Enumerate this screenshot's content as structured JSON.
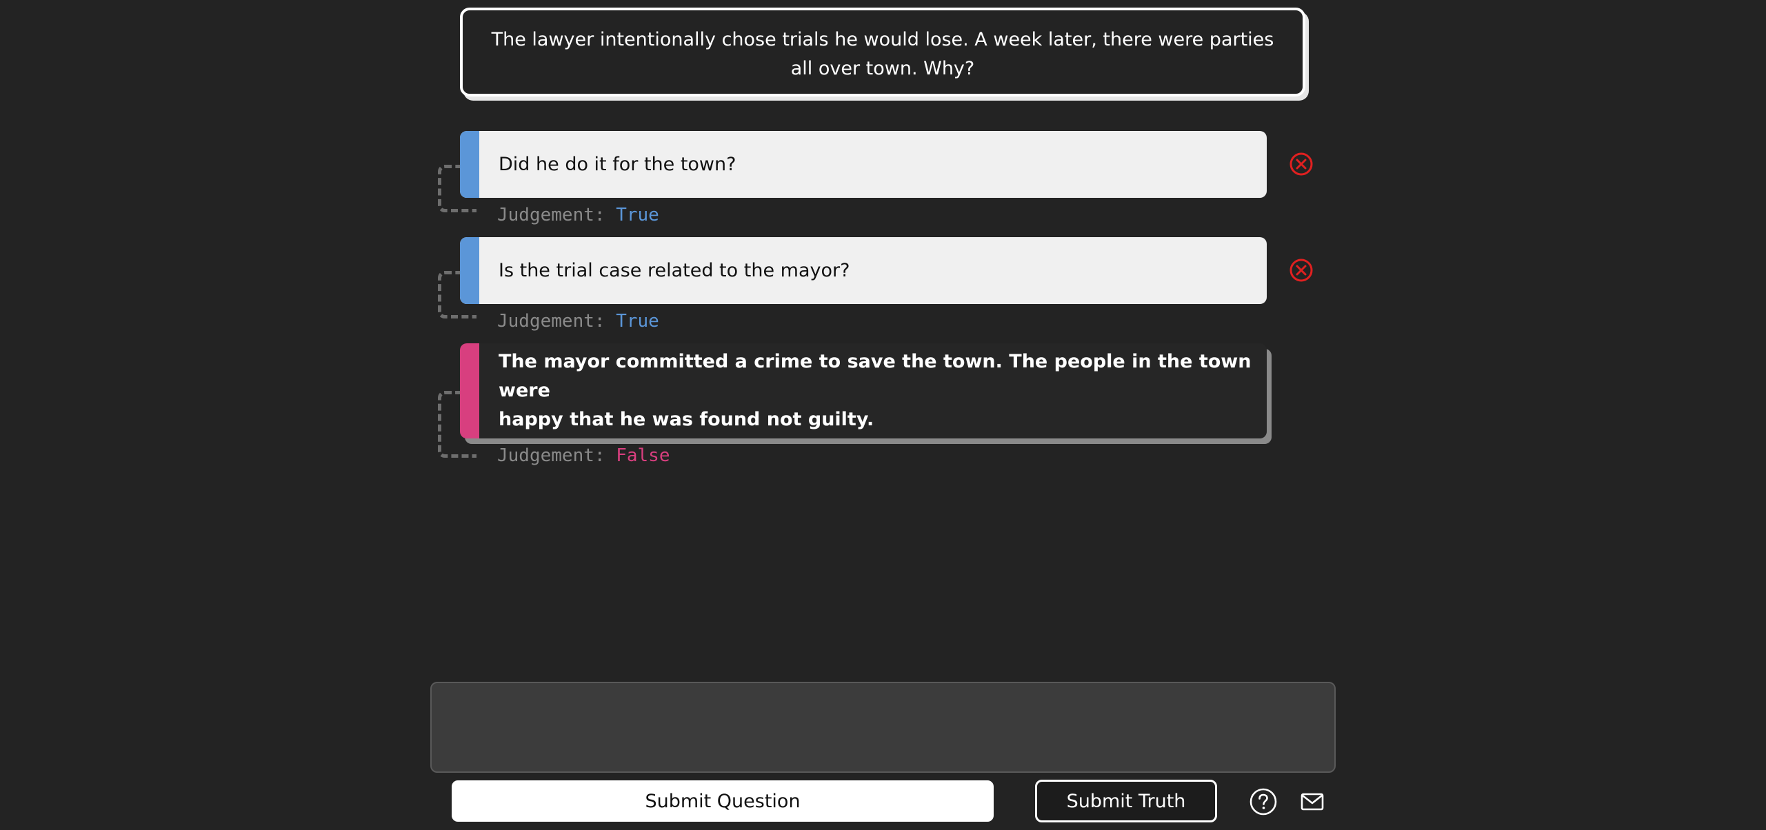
{
  "puzzle": {
    "prompt": "The lawyer intentionally chose trials he would lose. A week later, there were parties all over town. Why?"
  },
  "entries": [
    {
      "kind": "question",
      "text": "Did he do it for the town?",
      "judgement_label": "Judgement:",
      "judgement_value": "True",
      "delete_icon": "close-circle-icon"
    },
    {
      "kind": "question",
      "text": "Is the trial case related to the mayor?",
      "judgement_label": "Judgement:",
      "judgement_value": "True",
      "delete_icon": "close-circle-icon"
    },
    {
      "kind": "truth",
      "text_line1": "The mayor committed a crime to save the town. The people in the town were",
      "text_line2": "happy that he was found not guilty.",
      "judgement_label": "Judgement:",
      "judgement_value": "False"
    }
  ],
  "input": {
    "value": "",
    "placeholder": ""
  },
  "buttons": {
    "submit_question": "Submit Question",
    "submit_truth": "Submit Truth"
  },
  "icons": {
    "help": "help-circle-icon",
    "mail": "mail-icon"
  },
  "colors": {
    "background": "#232323",
    "question_accent": "#5b96d8",
    "truth_accent": "#d83f7f",
    "delete_red": "#e02020",
    "judgement_label": "#8a8a8a"
  }
}
